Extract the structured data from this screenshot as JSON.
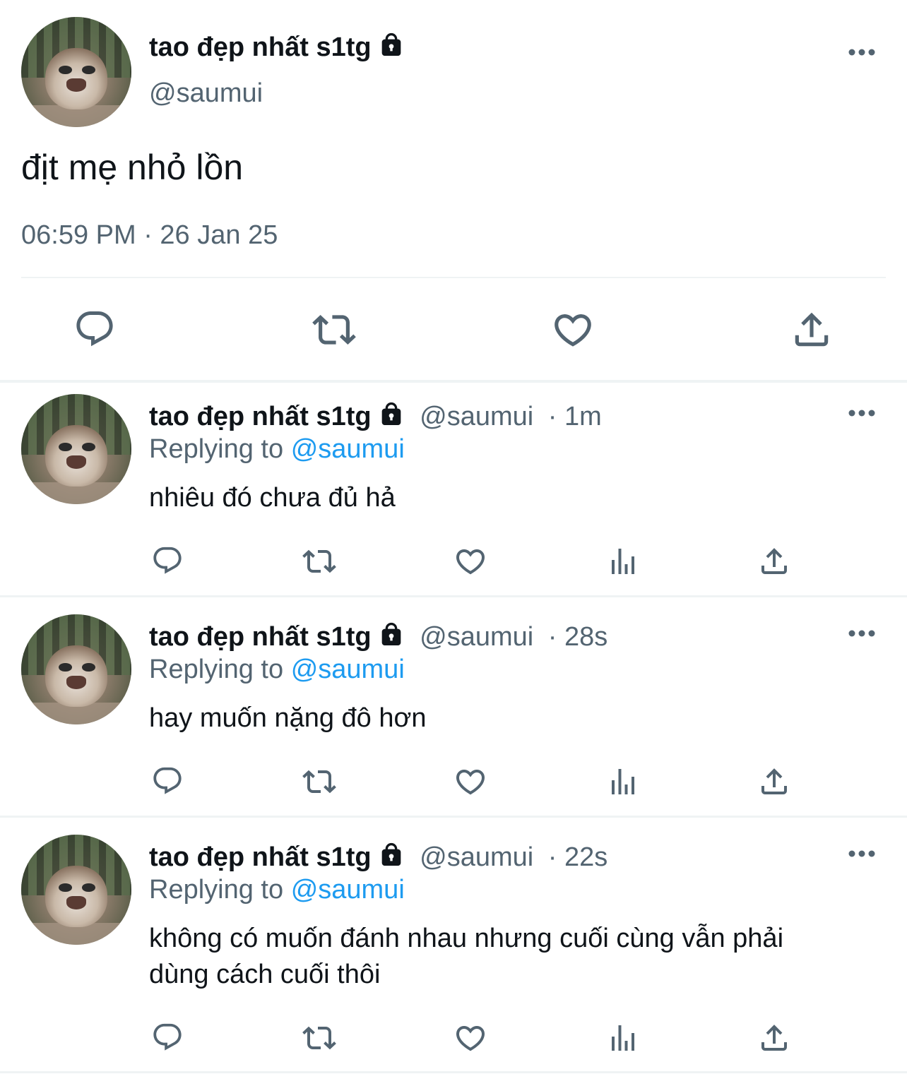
{
  "main_tweet": {
    "display_name": "tao đẹp nhất s1tg",
    "handle": "@saumui",
    "text": "địt mẹ nhỏ lồn",
    "timestamp": "06:59 PM · 26 Jan 25"
  },
  "replies": [
    {
      "display_name": "tao đẹp nhất s1tg",
      "handle": "@saumui",
      "time": "· 1m",
      "replying_prefix": "Replying to",
      "replying_handle": "@saumui",
      "text": "nhiêu đó chưa đủ hả"
    },
    {
      "display_name": "tao đẹp nhất s1tg",
      "handle": "@saumui",
      "time": "· 28s",
      "replying_prefix": "Replying to",
      "replying_handle": "@saumui",
      "text": "hay muốn nặng đô hơn"
    },
    {
      "display_name": "tao đẹp nhất s1tg",
      "handle": "@saumui",
      "time": "· 22s",
      "replying_prefix": "Replying to",
      "replying_handle": "@saumui",
      "text": "không có muốn đánh nhau nhưng cuối cùng vẫn phải dùng cách cuối thôi"
    }
  ],
  "icons": {
    "reply": "comment-bubble-icon",
    "retweet": "retweet-icon",
    "like": "heart-icon",
    "views": "analytics-bars-icon",
    "share": "share-upload-icon",
    "lock": "lock-icon",
    "more": "more-dots-icon"
  },
  "colors": {
    "text": "#0f1419",
    "secondary": "#536471",
    "link": "#1d9bf0",
    "divider": "#eff3f4"
  }
}
